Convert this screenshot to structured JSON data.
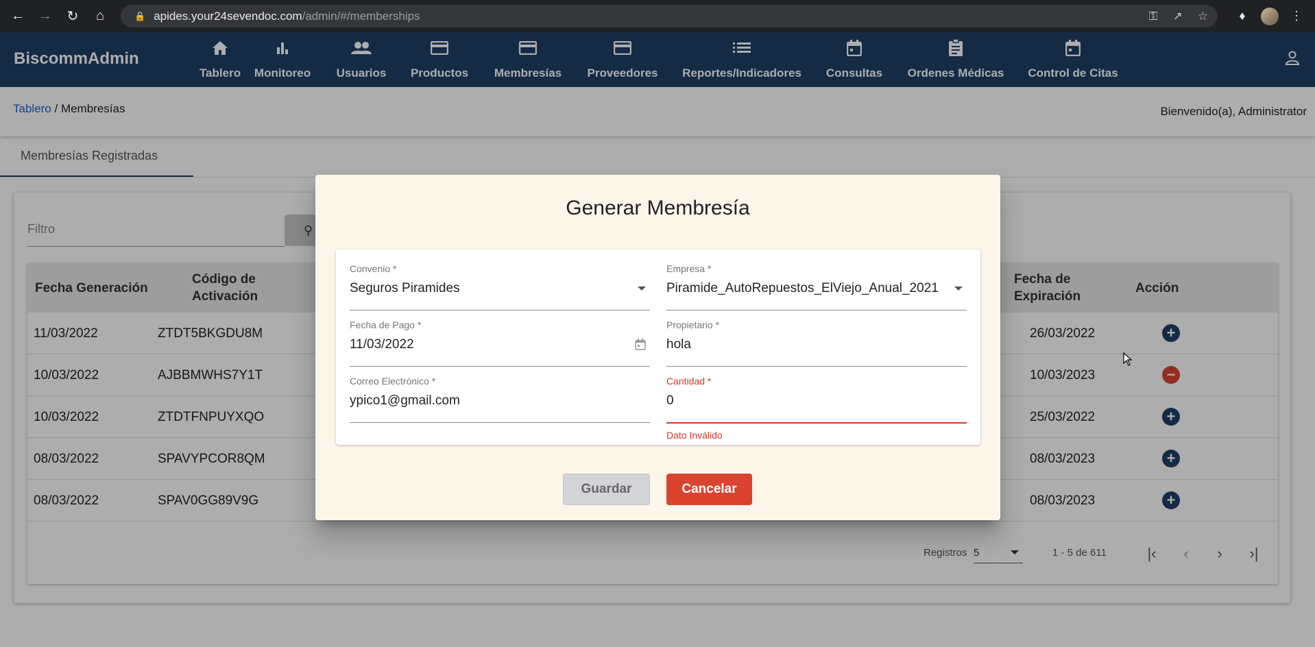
{
  "browser": {
    "url_host": "apides.your24sevendoc.com",
    "url_path": "/admin/#/memberships"
  },
  "app": {
    "brand": "BiscommAdmin",
    "nav": [
      {
        "label": "Tablero",
        "icon": "home-icon"
      },
      {
        "label": "Monitoreo",
        "icon": "bar-chart-icon"
      },
      {
        "label": "Usuarios",
        "icon": "people-icon"
      },
      {
        "label": "Productos",
        "icon": "card-icon"
      },
      {
        "label": "Membresías",
        "icon": "card-icon"
      },
      {
        "label": "Proveedores",
        "icon": "card-icon"
      },
      {
        "label": "Reportes/Indicadores",
        "icon": "list-icon"
      },
      {
        "label": "Consultas",
        "icon": "calendar-icon"
      },
      {
        "label": "Ordenes Médicas",
        "icon": "clipboard-icon"
      },
      {
        "label": "Control de Citas",
        "icon": "calendar-icon"
      }
    ]
  },
  "breadcrumb": {
    "home": "Tablero",
    "separator": " / ",
    "current": "Membresías"
  },
  "welcome": "Bienvenido(a), Administrator",
  "tab": "Membresías Registradas",
  "filter": {
    "placeholder": "Filtro"
  },
  "table": {
    "headers": {
      "fecha_generacion": "Fecha Generación",
      "codigo_1": "Código de",
      "codigo_2": "Activación",
      "expiracion_1": "Fecha de",
      "expiracion_2": "Expiración",
      "accion": "Acción"
    },
    "rows": [
      {
        "fecha": "11/03/2022",
        "codigo": "ZTDT5BKGDU8M",
        "expiracion": "26/03/2022",
        "action": "add"
      },
      {
        "fecha": "10/03/2022",
        "codigo": "AJBBMWHS7Y1T",
        "expiracion": "10/03/2023",
        "action": "remove"
      },
      {
        "fecha": "10/03/2022",
        "codigo": "ZTDTFNPUYXQO",
        "expiracion": "25/03/2022",
        "action": "add"
      },
      {
        "fecha": "08/03/2022",
        "codigo": "SPAVYPCOR8QM",
        "expiracion": "08/03/2023",
        "action": "add"
      },
      {
        "fecha": "08/03/2022",
        "codigo": "SPAV0GG89V9G",
        "expiracion": "08/03/2023",
        "action": "add"
      }
    ],
    "paginator": {
      "label": "Registros",
      "page_size": "5",
      "range": "1 - 5 de 611"
    }
  },
  "colors": {
    "header": "#1e3f66",
    "add": "#1e3f66",
    "remove": "#d9432f",
    "error": "#d3382a",
    "dialog_bg": "#fcf5ea"
  },
  "dialog": {
    "title": "Generar Membresía",
    "fields": {
      "convenio": {
        "label": "Convenio *",
        "value": "Seguros Piramides"
      },
      "empresa": {
        "label": "Empresa *",
        "value": "Piramide_AutoRepuestos_ElViejo_Anual_2021"
      },
      "fecha_pago": {
        "label": "Fecha de Pago *",
        "value": "11/03/2022"
      },
      "propietario": {
        "label": "Propietario *",
        "value": "hola"
      },
      "correo": {
        "label": "Correo Electrónico *",
        "value": "ypico1@gmail.com"
      },
      "cantidad": {
        "label": "Cantidad *",
        "value": "0",
        "error": "Dato Inválido"
      }
    },
    "save_label": "Guardar",
    "cancel_label": "Cancelar"
  }
}
